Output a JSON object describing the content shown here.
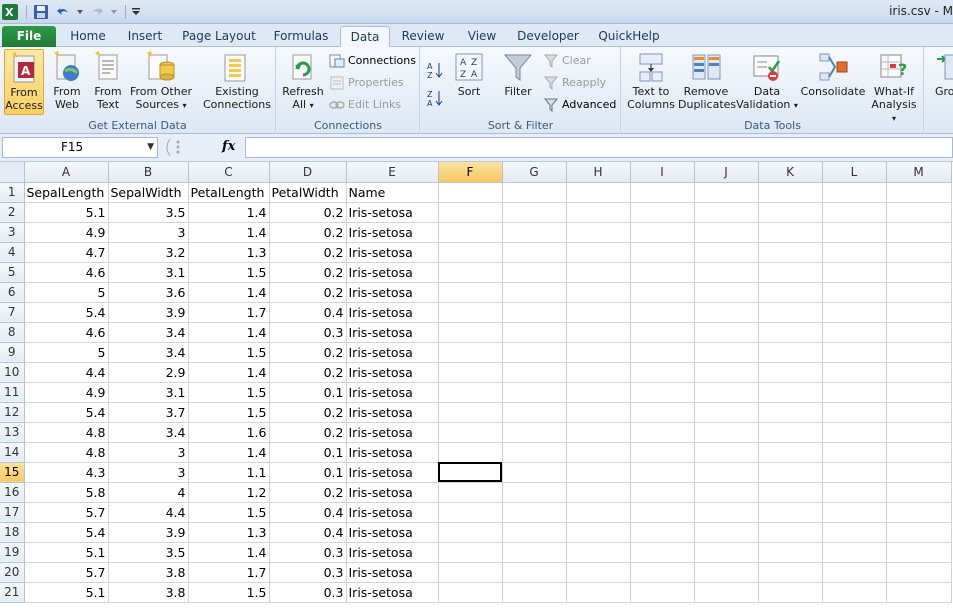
{
  "window": {
    "title": "iris.csv - M"
  },
  "tabs": [
    "File",
    "Home",
    "Insert",
    "Page Layout",
    "Formulas",
    "Data",
    "Review",
    "View",
    "Developer",
    "QuickHelp"
  ],
  "ribbon": {
    "get_external": {
      "label": "Get External Data",
      "from_access": "From Access",
      "from_access_l1": "From",
      "from_access_l2": "Access",
      "from_web_l1": "From",
      "from_web_l2": "Web",
      "from_text_l1": "From",
      "from_text_l2": "Text",
      "from_other_l1": "From Other",
      "from_other_l2": "Sources",
      "existing_l1": "Existing",
      "existing_l2": "Connections"
    },
    "connections": {
      "label": "Connections",
      "refresh_l1": "Refresh",
      "refresh_l2": "All",
      "connections": "Connections",
      "properties": "Properties",
      "edit_links": "Edit Links"
    },
    "sort_filter": {
      "label": "Sort & Filter",
      "sort": "Sort",
      "filter": "Filter",
      "clear": "Clear",
      "reapply": "Reapply",
      "advanced": "Advanced"
    },
    "data_tools": {
      "label": "Data Tools",
      "text_to_l1": "Text to",
      "text_to_l2": "Columns",
      "remove_l1": "Remove",
      "remove_l2": "Duplicates",
      "validation_l1": "Data",
      "validation_l2": "Validation",
      "consolidate": "Consolidate",
      "whatif_l1": "What-If",
      "whatif_l2": "Analysis"
    },
    "outline": {
      "group_l1": "Gro"
    }
  },
  "formula_bar": {
    "name_box": "F15",
    "fx": "fx",
    "formula": ""
  },
  "sheet": {
    "columns": [
      "A",
      "B",
      "C",
      "D",
      "E",
      "F",
      "G",
      "H",
      "I",
      "J",
      "K",
      "L",
      "M"
    ],
    "selected_col": "F",
    "selected_row": 15,
    "rows": [
      [
        "SepalLength",
        "SepalWidth",
        "PetalLength",
        "PetalWidth",
        "Name"
      ],
      [
        "5.1",
        "3.5",
        "1.4",
        "0.2",
        "Iris-setosa"
      ],
      [
        "4.9",
        "3",
        "1.4",
        "0.2",
        "Iris-setosa"
      ],
      [
        "4.7",
        "3.2",
        "1.3",
        "0.2",
        "Iris-setosa"
      ],
      [
        "4.6",
        "3.1",
        "1.5",
        "0.2",
        "Iris-setosa"
      ],
      [
        "5",
        "3.6",
        "1.4",
        "0.2",
        "Iris-setosa"
      ],
      [
        "5.4",
        "3.9",
        "1.7",
        "0.4",
        "Iris-setosa"
      ],
      [
        "4.6",
        "3.4",
        "1.4",
        "0.3",
        "Iris-setosa"
      ],
      [
        "5",
        "3.4",
        "1.5",
        "0.2",
        "Iris-setosa"
      ],
      [
        "4.4",
        "2.9",
        "1.4",
        "0.2",
        "Iris-setosa"
      ],
      [
        "4.9",
        "3.1",
        "1.5",
        "0.1",
        "Iris-setosa"
      ],
      [
        "5.4",
        "3.7",
        "1.5",
        "0.2",
        "Iris-setosa"
      ],
      [
        "4.8",
        "3.4",
        "1.6",
        "0.2",
        "Iris-setosa"
      ],
      [
        "4.8",
        "3",
        "1.4",
        "0.1",
        "Iris-setosa"
      ],
      [
        "4.3",
        "3",
        "1.1",
        "0.1",
        "Iris-setosa"
      ],
      [
        "5.8",
        "4",
        "1.2",
        "0.2",
        "Iris-setosa"
      ],
      [
        "5.7",
        "4.4",
        "1.5",
        "0.4",
        "Iris-setosa"
      ],
      [
        "5.4",
        "3.9",
        "1.3",
        "0.4",
        "Iris-setosa"
      ],
      [
        "5.1",
        "3.5",
        "1.4",
        "0.3",
        "Iris-setosa"
      ],
      [
        "5.7",
        "3.8",
        "1.7",
        "0.3",
        "Iris-setosa"
      ],
      [
        "5.1",
        "3.8",
        "1.5",
        "0.3",
        "Iris-setosa"
      ]
    ]
  },
  "colors": {
    "file_tab": "#2a8f42",
    "selection_header": "#f7c962",
    "grid_line": "#d4d4d4"
  }
}
